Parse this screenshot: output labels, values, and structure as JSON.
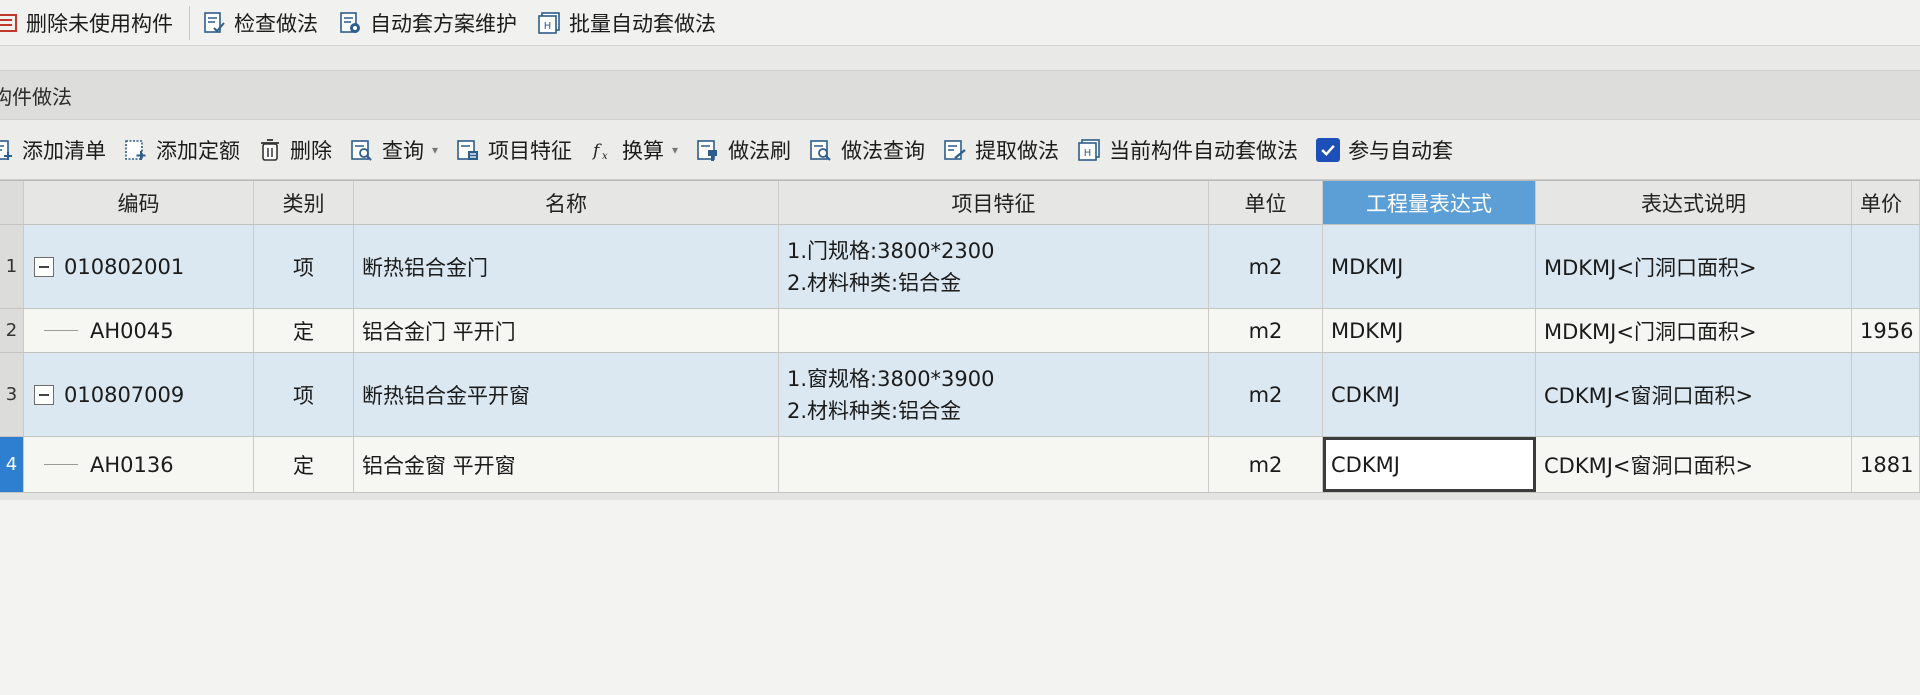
{
  "top_toolbar": {
    "items": [
      {
        "label": "删除未使用构件",
        "icon": "list-delete-icon"
      },
      {
        "label": "检查做法",
        "icon": "check-method-icon"
      },
      {
        "label": "自动套方案维护",
        "icon": "auto-scheme-icon"
      },
      {
        "label": "批量自动套做法",
        "icon": "batch-auto-icon"
      }
    ]
  },
  "panel": {
    "title": "构件做法"
  },
  "sub_toolbar": {
    "add_list": "添加清单",
    "add_quota": "添加定额",
    "delete": "删除",
    "query": "查询",
    "item_features": "项目特征",
    "convert": "换算",
    "method_brush": "做法刷",
    "method_query": "做法查询",
    "extract_method": "提取做法",
    "current_auto": "当前构件自动套做法",
    "participate_auto": "参与自动套",
    "participate_checked": true
  },
  "table": {
    "headers": {
      "code": "编码",
      "type": "类别",
      "name": "名称",
      "features": "项目特征",
      "unit": "单位",
      "expression": "工程量表达式",
      "description": "表达式说明",
      "price": "单价"
    },
    "rows": [
      {
        "num": "1",
        "code": "010802001",
        "type": "项",
        "name": "断热铝合金门",
        "feature1": "1.门规格:3800*2300",
        "feature2": "2.材料种类:铝合金",
        "unit": "m2",
        "expression": "MDKMJ",
        "description": "MDKMJ<门洞口面积>",
        "price": ""
      },
      {
        "num": "2",
        "code": "AH0045",
        "type": "定",
        "name": "铝合金门 平开门",
        "feature1": "",
        "feature2": "",
        "unit": "m2",
        "expression": "MDKMJ",
        "description": "MDKMJ<门洞口面积>",
        "price": "1956"
      },
      {
        "num": "3",
        "code": "010807009",
        "type": "项",
        "name": "断热铝合金平开窗",
        "feature1": "1.窗规格:3800*3900",
        "feature2": "2.材料种类:铝合金",
        "unit": "m2",
        "expression": "CDKMJ",
        "description": "CDKMJ<窗洞口面积>",
        "price": ""
      },
      {
        "num": "4",
        "code": "AH0136",
        "type": "定",
        "name": "铝合金窗 平开窗",
        "feature1": "",
        "feature2": "",
        "unit": "m2",
        "expression": "CDKMJ",
        "description": "CDKMJ<窗洞口面积>",
        "price": "1881"
      }
    ]
  },
  "colors": {
    "active_header": "#5c9fd6",
    "bill_row": "#dbe8f1",
    "checkbox": "#1d4fb8"
  }
}
